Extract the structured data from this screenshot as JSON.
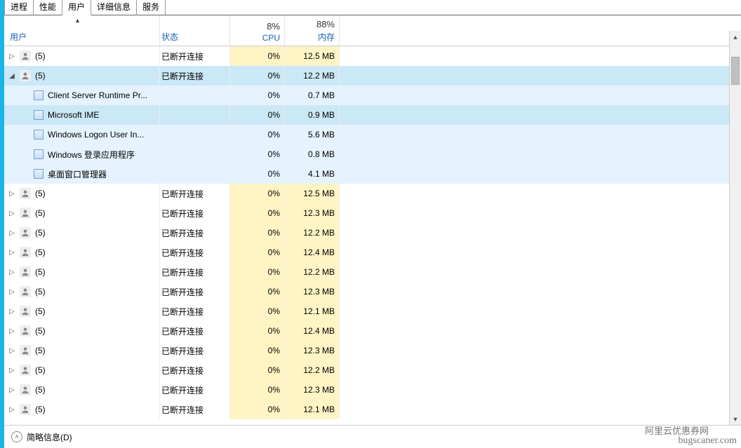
{
  "tabs": [
    "进程",
    "性能",
    "用户",
    "详细信息",
    "服务"
  ],
  "active_tab": 2,
  "columns": {
    "user": "用户",
    "status": "状态",
    "cpu_label": "CPU",
    "cpu_pct": "8%",
    "mem_label": "内存",
    "mem_pct": "88%"
  },
  "rows": [
    {
      "type": "user",
      "expanded": false,
      "name": "(5)",
      "status": "已断开连接",
      "cpu": "0%",
      "mem": "12.5 MB"
    },
    {
      "type": "user",
      "expanded": true,
      "selected": true,
      "name": "(5)",
      "status": "已断开连接",
      "cpu": "0%",
      "mem": "12.2 MB"
    },
    {
      "type": "proc",
      "parentSelected": true,
      "name": "Client Server Runtime Pr...",
      "cpu": "0%",
      "mem": "0.7 MB"
    },
    {
      "type": "proc",
      "parentSelected": true,
      "selected": true,
      "name": "Microsoft IME",
      "cpu": "0%",
      "mem": "0.9 MB"
    },
    {
      "type": "proc",
      "parentSelected": true,
      "name": "Windows Logon User In...",
      "cpu": "0%",
      "mem": "5.6 MB"
    },
    {
      "type": "proc",
      "parentSelected": true,
      "name": "Windows 登录应用程序",
      "cpu": "0%",
      "mem": "0.8 MB"
    },
    {
      "type": "proc",
      "parentSelected": true,
      "name": "桌面窗口管理器",
      "cpu": "0%",
      "mem": "4.1 MB"
    },
    {
      "type": "user",
      "expanded": false,
      "name": "(5)",
      "status": "已断开连接",
      "cpu": "0%",
      "mem": "12.5 MB"
    },
    {
      "type": "user",
      "expanded": false,
      "name": "(5)",
      "status": "已断开连接",
      "cpu": "0%",
      "mem": "12.3 MB"
    },
    {
      "type": "user",
      "expanded": false,
      "name": "(5)",
      "status": "已断开连接",
      "cpu": "0%",
      "mem": "12.2 MB"
    },
    {
      "type": "user",
      "expanded": false,
      "name": "(5)",
      "status": "已断开连接",
      "cpu": "0%",
      "mem": "12.4 MB"
    },
    {
      "type": "user",
      "expanded": false,
      "name": "(5)",
      "status": "已断开连接",
      "cpu": "0%",
      "mem": "12.2 MB"
    },
    {
      "type": "user",
      "expanded": false,
      "name": "(5)",
      "status": "已断开连接",
      "cpu": "0%",
      "mem": "12.3 MB"
    },
    {
      "type": "user",
      "expanded": false,
      "name": "(5)",
      "status": "已断开连接",
      "cpu": "0%",
      "mem": "12.1 MB"
    },
    {
      "type": "user",
      "expanded": false,
      "name": "(5)",
      "status": "已断开连接",
      "cpu": "0%",
      "mem": "12.4 MB"
    },
    {
      "type": "user",
      "expanded": false,
      "name": "(5)",
      "status": "已断开连接",
      "cpu": "0%",
      "mem": "12.3 MB"
    },
    {
      "type": "user",
      "expanded": false,
      "name": "(5)",
      "status": "已断开连接",
      "cpu": "0%",
      "mem": "12.2 MB"
    },
    {
      "type": "user",
      "expanded": false,
      "name": "(5)",
      "status": "已断开连接",
      "cpu": "0%",
      "mem": "12.3 MB"
    },
    {
      "type": "user",
      "expanded": false,
      "name": "(5)",
      "status": "已断开连接",
      "cpu": "0%",
      "mem": "12.1 MB"
    }
  ],
  "footer": {
    "label": "简略信息(D)"
  },
  "watermark": {
    "cn": "阿里云优惠券网",
    "en": "bugscaner.com"
  }
}
